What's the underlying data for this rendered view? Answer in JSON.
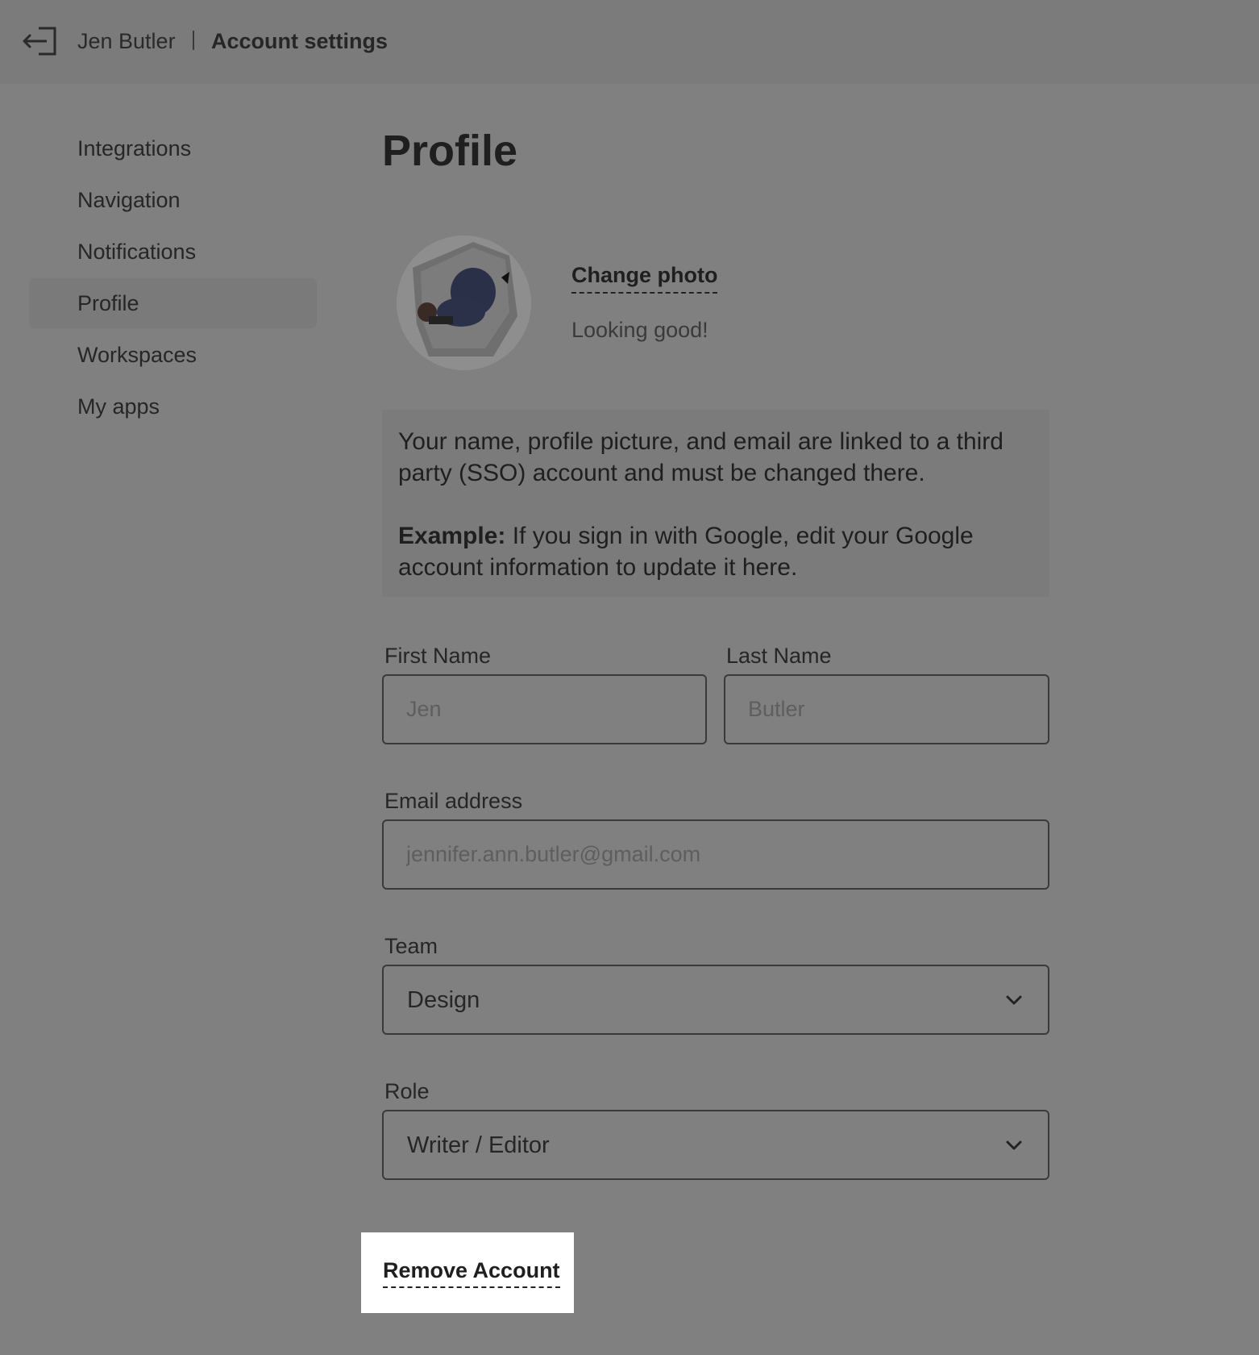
{
  "header": {
    "user_name": "Jen Butler",
    "title": "Account settings",
    "back_icon": "exit-arrow-icon"
  },
  "sidebar": {
    "items": [
      {
        "label": "Integrations",
        "active": false
      },
      {
        "label": "Navigation",
        "active": false
      },
      {
        "label": "Notifications",
        "active": false
      },
      {
        "label": "Profile",
        "active": true
      },
      {
        "label": "Workspaces",
        "active": false
      },
      {
        "label": "My apps",
        "active": false
      }
    ]
  },
  "main": {
    "title": "Profile",
    "photo": {
      "change_label": "Change photo",
      "caption": "Looking good!"
    },
    "notice": {
      "text": "Your name, profile picture, and email are linked to a third party (SSO) account and must be changed there.",
      "example_label": "Example:",
      "example_text": " If you sign in with Google, edit your Google account information to update it here."
    },
    "form": {
      "first_name": {
        "label": "First Name",
        "placeholder": "Jen"
      },
      "last_name": {
        "label": "Last Name",
        "placeholder": "Butler"
      },
      "email": {
        "label": "Email address",
        "placeholder": "jennifer.ann.butler@gmail.com"
      },
      "team": {
        "label": "Team",
        "value": "Design"
      },
      "role": {
        "label": "Role",
        "value": "Writer / Editor"
      }
    },
    "remove_account_label": "Remove Account"
  },
  "colors": {
    "overlay": "#808080",
    "text": "#232323",
    "highlight": "#ffffff"
  }
}
